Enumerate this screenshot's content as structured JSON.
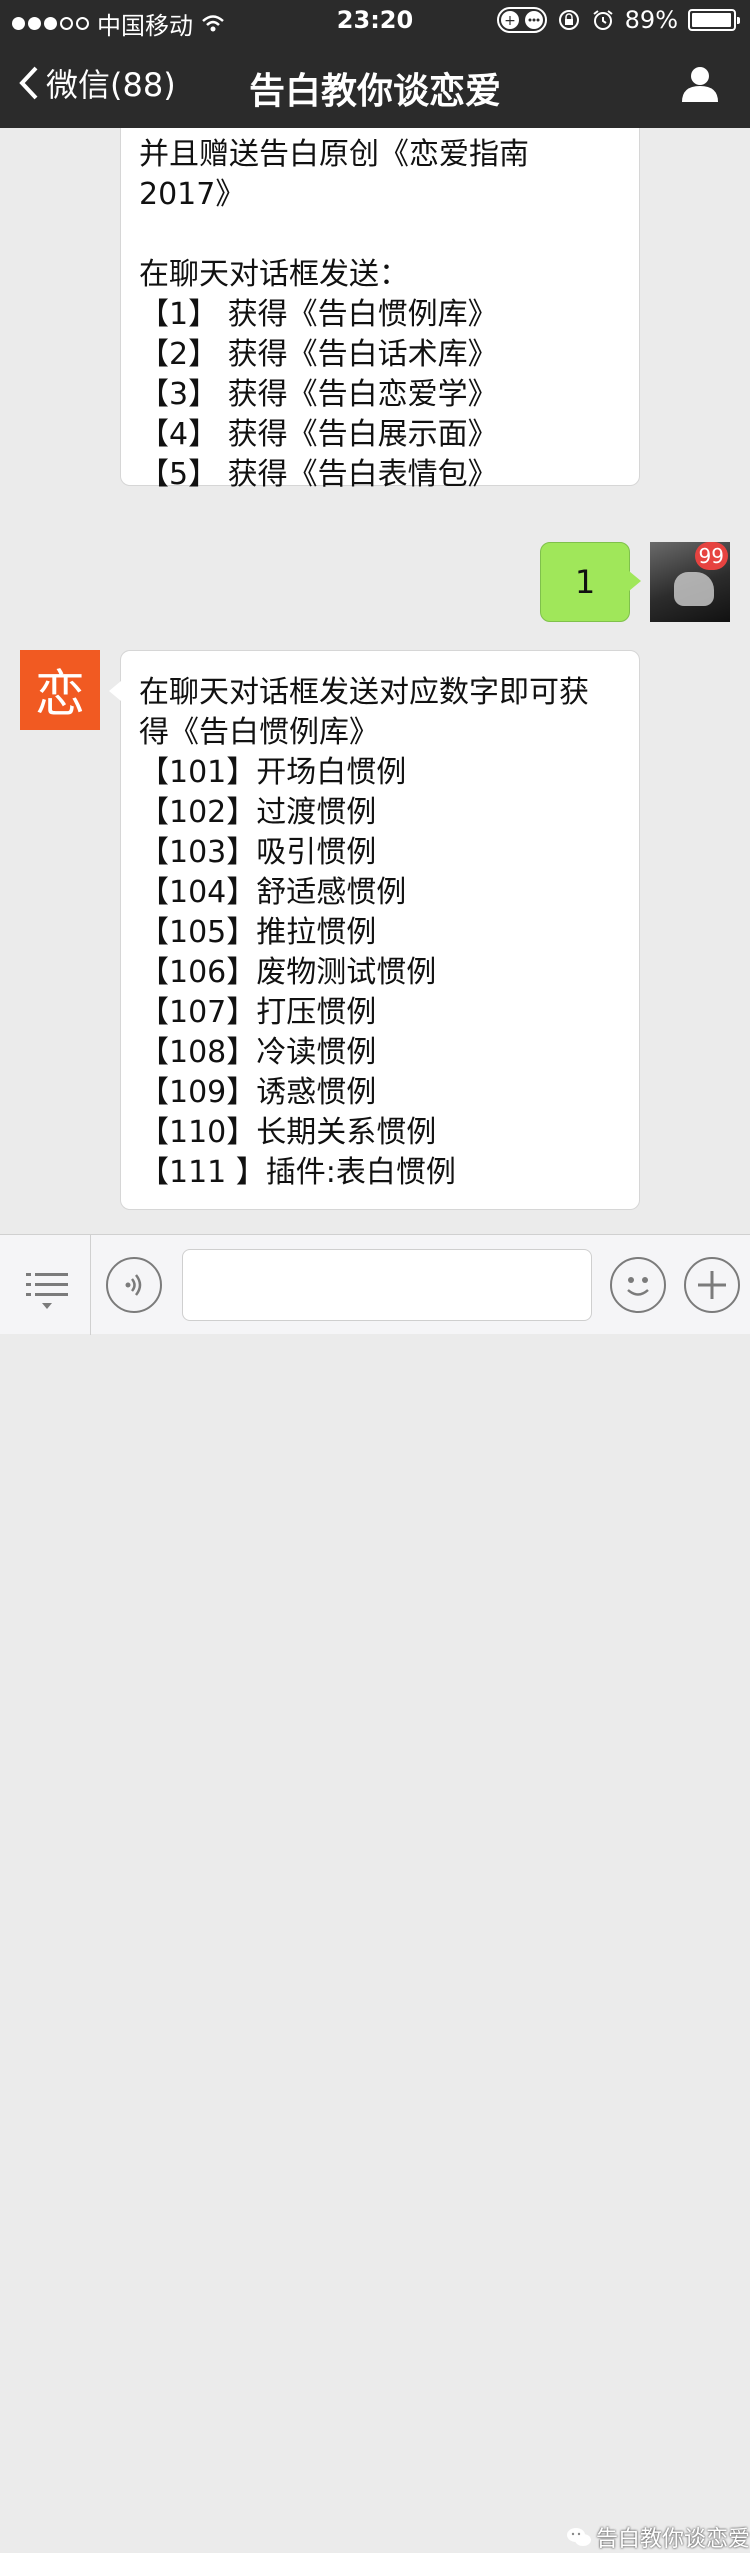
{
  "status_bar": {
    "carrier": "中国移动",
    "time": "23:20",
    "battery_percent": "89%",
    "battery_level": 0.89,
    "signal_dots_filled": 3,
    "signal_dots_total": 5
  },
  "nav": {
    "back_label": "微信(88)",
    "title": "告白教你谈恋爱",
    "profile_icon": "person-icon"
  },
  "messages": {
    "first_bubble_lines": [
      "并且赠送告白原创《恋爱指南",
      "2017》",
      "",
      "在聊天对话框发送：",
      "【1】 获得《告白惯例库》",
      "【2】 获得《告白话术库》",
      "【3】 获得《告白恋爱学》",
      "【4】 获得《告白展示面》",
      "【5】 获得《告白表情包》"
    ],
    "user_reply": "1",
    "user_badge": "99",
    "bot_avatar_char": "恋",
    "bot_reply_lines": [
      "在聊天对话框发送对应数字即可获",
      "得《告白惯例库》",
      "【101】开场白惯例",
      "【102】过渡惯例",
      "【103】吸引惯例",
      "【104】舒适感惯例",
      "【105】推拉惯例",
      "【106】废物测试惯例",
      "【107】打压惯例",
      "【108】冷读惯例",
      "【109】诱惑惯例",
      "【110】长期关系惯例",
      "【111 】插件:表白惯例"
    ]
  },
  "toolbar": {
    "menu_icon": "menu-list-icon",
    "voice_icon": "voice-icon",
    "input_value": "",
    "emoji_icon": "emoji-icon",
    "plus_icon": "plus-icon",
    "watermark": "告白教你谈恋爱"
  },
  "colors": {
    "bar_bg": "#2b2b2b",
    "chat_bg": "#ebebeb",
    "user_bubble": "#a0e75a",
    "bot_avatar": "#f15a22",
    "badge": "#e64340"
  }
}
